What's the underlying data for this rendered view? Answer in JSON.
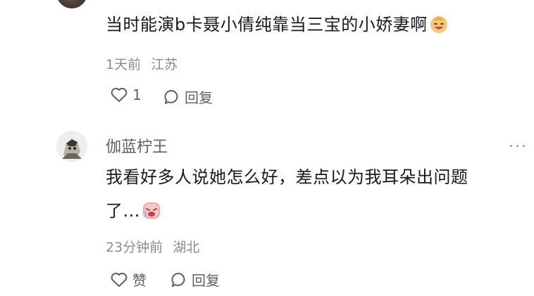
{
  "comment1": {
    "text": "当时能演b卡聂小倩纯靠当三宝的小娇妻啊",
    "time": "1天前",
    "location": "江苏",
    "like_count": "1",
    "reply_label": "回复"
  },
  "comment2": {
    "username": "伽蓝柠王",
    "text_line1": "我看好多人说她怎么好，差点以为我耳朵出问题",
    "text_line2": "了...",
    "time": "23分钟前",
    "location": "湖北",
    "like_label": "赞",
    "reply_label": "回复",
    "more_label": "..."
  },
  "colors": {
    "text": "#161823",
    "meta": "#8a8b91",
    "icon": "#5f6066"
  }
}
